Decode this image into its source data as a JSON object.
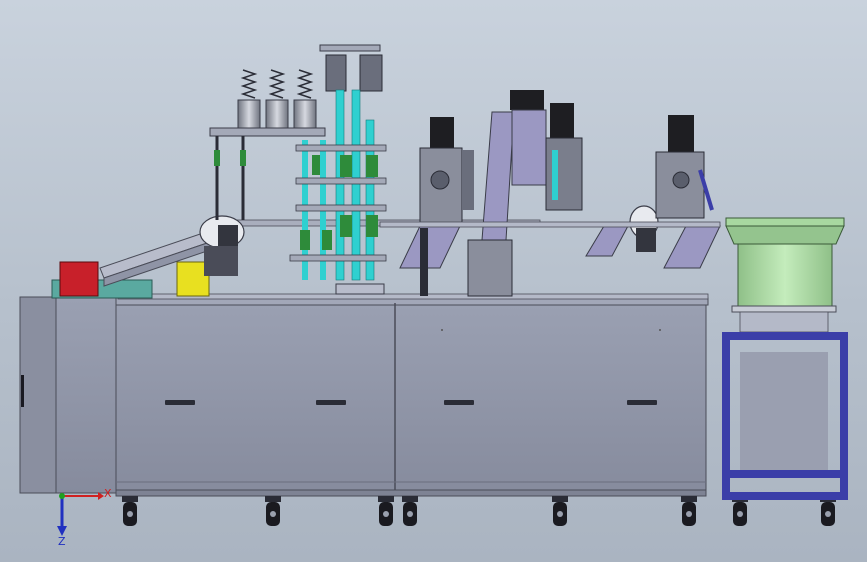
{
  "scene": {
    "background_top": "#c9d2dd",
    "background_bottom": "#aab4c1",
    "cabinet_color": "#8f94a6",
    "cabinet_edge": "#5e6070",
    "frame_color": "#3b3ea8",
    "feeder_bowl_color": "#a8d8a0",
    "spring_color": "#2e8b3a",
    "cyan_rod_color": "#2fd0d0",
    "motor_color": "#1e1e22",
    "red_box_color": "#c8202a",
    "yellow_box_color": "#e8e020"
  },
  "triad": {
    "x_label": "X",
    "z_label": "Z",
    "x_color": "#d02020",
    "y_color": "#20a020",
    "z_color": "#2030c0"
  }
}
